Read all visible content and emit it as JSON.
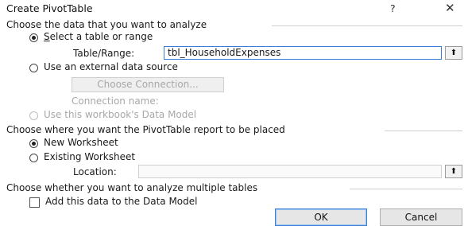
{
  "dialog": {
    "title": "Create PivotTable",
    "help_glyph": "?",
    "close_glyph": "✕"
  },
  "section1": {
    "heading": "Choose the data that you want to analyze",
    "select_table_option": "Select a table or range",
    "table_range_label": "Table/Range:",
    "table_range_value": "tbl_HouseholdExpenses",
    "external_option": "Use an external data source",
    "choose_connection_label": "Choose Connection...",
    "connection_name_label": "Connection name:",
    "data_model_option": "Use this workbook's Data Model"
  },
  "section2": {
    "heading": "Choose where you want the PivotTable report to be placed",
    "new_worksheet_option": "New Worksheet",
    "existing_worksheet_option": "Existing Worksheet",
    "location_label": "Location:",
    "location_value": ""
  },
  "section3": {
    "heading": "Choose whether you want to analyze multiple tables",
    "add_data_model_label": "Add this data to the Data Model"
  },
  "buttons": {
    "ok": "OK",
    "cancel": "Cancel",
    "range_picker_glyph": "⬆"
  },
  "state": {
    "select_table_selected": true,
    "new_worksheet_selected": true,
    "add_data_model_checked": false
  }
}
